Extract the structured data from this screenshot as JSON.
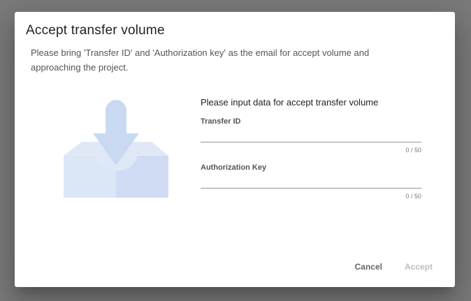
{
  "dialog": {
    "title": "Accept transfer volume",
    "description": "Please bring 'Transfer ID' and 'Authorization key' as the email for accept volume and approaching the project.",
    "illustration_icon": "inbox-download-icon",
    "form": {
      "heading": "Please input data for accept transfer volume",
      "fields": [
        {
          "label": "Transfer ID",
          "value": "",
          "counter": "0 / 50"
        },
        {
          "label": "Authorization Key",
          "value": "",
          "counter": "0 / 50"
        }
      ]
    },
    "actions": {
      "cancel_label": "Cancel",
      "accept_label": "Accept"
    }
  },
  "colors": {
    "backdrop": "#7a7a7a",
    "illustration": "#c9d9f2",
    "accept_disabled": "#bdbdbd"
  }
}
